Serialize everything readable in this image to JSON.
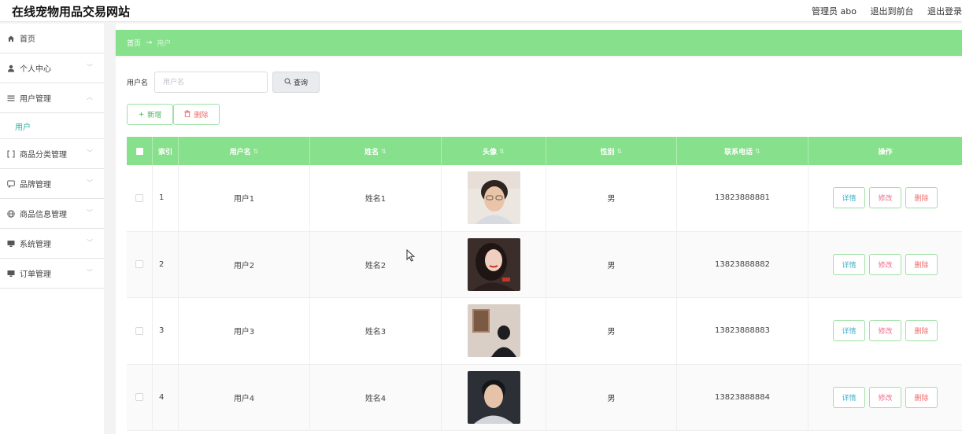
{
  "header": {
    "site_title": "在线宠物用品交易网站",
    "admin_label": "管理员 abo",
    "to_front": "退出到前台",
    "logout": "退出登录"
  },
  "sidebar": {
    "items": [
      {
        "label": "首页",
        "icon": "home-icon"
      },
      {
        "label": "个人中心",
        "icon": "user-icon"
      },
      {
        "label": "用户管理",
        "icon": "list-icon"
      },
      {
        "label": "商品分类管理",
        "icon": "bracket-icon"
      },
      {
        "label": "品牌管理",
        "icon": "chat-icon"
      },
      {
        "label": "商品信息管理",
        "icon": "globe-icon"
      },
      {
        "label": "系统管理",
        "icon": "monitor-icon"
      },
      {
        "label": "订单管理",
        "icon": "monitor-icon"
      }
    ],
    "submenu_user": "用户"
  },
  "breadcrumb": {
    "home": "首页",
    "arrow": "→",
    "current": "用户"
  },
  "search": {
    "label": "用户名",
    "placeholder": "用户名",
    "button": "查询"
  },
  "actions": {
    "add": "新增",
    "delete": "删除"
  },
  "table": {
    "headers": [
      "索引",
      "用户名",
      "姓名",
      "头像",
      "性别",
      "联系电话",
      "操作"
    ],
    "rows": [
      {
        "index": "1",
        "username": "用户1",
        "name": "姓名1",
        "gender": "男",
        "phone": "13823888881"
      },
      {
        "index": "2",
        "username": "用户2",
        "name": "姓名2",
        "gender": "男",
        "phone": "13823888882"
      },
      {
        "index": "3",
        "username": "用户3",
        "name": "姓名3",
        "gender": "男",
        "phone": "13823888883"
      },
      {
        "index": "4",
        "username": "用户4",
        "name": "姓名4",
        "gender": "男",
        "phone": "13823888884"
      }
    ],
    "row_ops": {
      "detail": "详情",
      "edit": "修改",
      "remove": "删除"
    }
  },
  "colors": {
    "accent": "#87e08b",
    "active_submenu": "#2bb3a3",
    "danger": "#f06b6b"
  }
}
